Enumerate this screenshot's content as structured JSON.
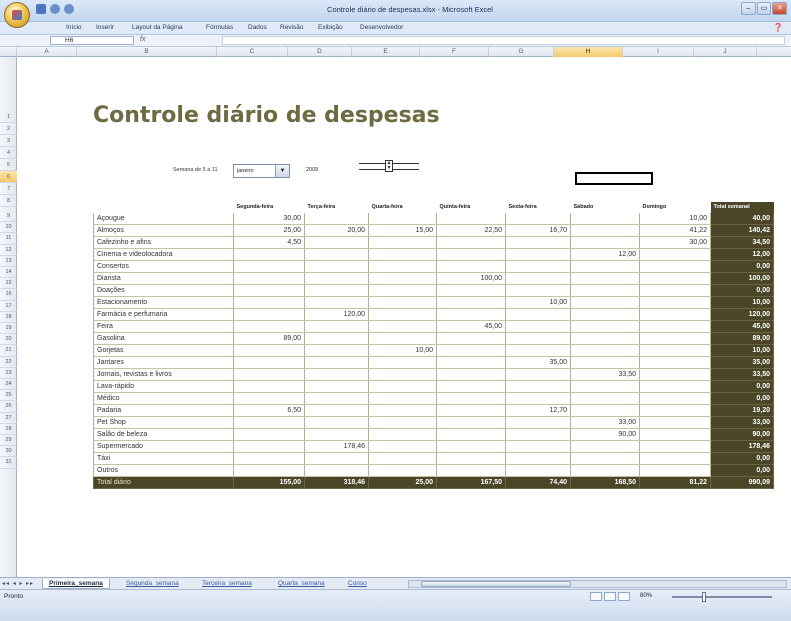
{
  "window": {
    "title": "Controle diário de despesas.xlsx - Microsoft Excel",
    "controls": [
      "–",
      "▭",
      "✕"
    ]
  },
  "ribbon": {
    "tabs": [
      "Início",
      "Inserir",
      "Layout da Página",
      "Fórmulas",
      "Dados",
      "Revisão",
      "Exibição",
      "Desenvolvedor"
    ],
    "help": "❓"
  },
  "formula_bar": {
    "name_box": "H6",
    "fx": "fx",
    "value": ""
  },
  "columns": [
    "A",
    "B",
    "C",
    "D",
    "E",
    "F",
    "G",
    "H",
    "I",
    "J"
  ],
  "selected_column": "H",
  "rows": [
    "1",
    "2",
    "3",
    "4",
    "5",
    "6",
    "7",
    "8",
    "9",
    "10",
    "11",
    "12",
    "13",
    "14",
    "15",
    "16",
    "17",
    "18",
    "19",
    "20",
    "21",
    "22",
    "23",
    "24",
    "25",
    "26",
    "27",
    "28",
    "29",
    "30",
    "31"
  ],
  "selected_row": "6",
  "sheet": {
    "title": "Controle diário de despesas",
    "week_label": "Semana de 5 a 11",
    "month": "janeiro",
    "year": "2009",
    "headers": [
      "",
      "Segunda-feira",
      "Terça-feira",
      "Quarta-feira",
      "Quinta-feira",
      "Sexta-feira",
      "Sábado",
      "Domingo",
      "Total semanal"
    ],
    "rows": [
      [
        "Açougue",
        "30,00",
        "",
        "",
        "",
        "",
        "",
        "10,00",
        "40,00"
      ],
      [
        "Almoços",
        "25,00",
        "20,00",
        "15,00",
        "22,50",
        "16,70",
        "",
        "41,22",
        "140,42"
      ],
      [
        "Cafezinho e afins",
        "4,50",
        "",
        "",
        "",
        "",
        "",
        "30,00",
        "34,50"
      ],
      [
        "Cinema e videolocadora",
        "",
        "",
        "",
        "",
        "",
        "12,00",
        "",
        "12,00"
      ],
      [
        "Consertos",
        "",
        "",
        "",
        "",
        "",
        "",
        "",
        "0,00"
      ],
      [
        "Diarista",
        "",
        "",
        "",
        "100,00",
        "",
        "",
        "",
        "100,00"
      ],
      [
        "Doações",
        "",
        "",
        "",
        "",
        "",
        "",
        "",
        "0,00"
      ],
      [
        "Estacionamento",
        "",
        "",
        "",
        "",
        "10,00",
        "",
        "",
        "10,00"
      ],
      [
        "Farmácia e perfumaria",
        "",
        "120,00",
        "",
        "",
        "",
        "",
        "",
        "120,00"
      ],
      [
        "Feira",
        "",
        "",
        "",
        "45,00",
        "",
        "",
        "",
        "45,00"
      ],
      [
        "Gasolina",
        "89,00",
        "",
        "",
        "",
        "",
        "",
        "",
        "89,00"
      ],
      [
        "Gorjetas",
        "",
        "",
        "10,00",
        "",
        "",
        "",
        "",
        "10,00"
      ],
      [
        "Jantares",
        "",
        "",
        "",
        "",
        "35,00",
        "",
        "",
        "35,00"
      ],
      [
        "Jornais, revistas e livros",
        "",
        "",
        "",
        "",
        "",
        "33,50",
        "",
        "33,50"
      ],
      [
        "Lava-rápido",
        "",
        "",
        "",
        "",
        "",
        "",
        "",
        "0,00"
      ],
      [
        "Médico",
        "",
        "",
        "",
        "",
        "",
        "",
        "",
        "0,00"
      ],
      [
        "Padaria",
        "6,50",
        "",
        "",
        "",
        "12,70",
        "",
        "",
        "19,20"
      ],
      [
        "Pet Shop",
        "",
        "",
        "",
        "",
        "",
        "33,00",
        "",
        "33,00"
      ],
      [
        "Salão de beleza",
        "",
        "",
        "",
        "",
        "",
        "90,00",
        "",
        "90,00"
      ],
      [
        "Supermercado",
        "",
        "178,46",
        "",
        "",
        "",
        "",
        "",
        "178,46"
      ],
      [
        "Táxi",
        "",
        "",
        "",
        "",
        "",
        "",
        "",
        "0,00"
      ],
      [
        "Outros",
        "",
        "",
        "",
        "",
        "",
        "",
        "",
        "0,00"
      ]
    ],
    "total_row": [
      "Total diário",
      "155,00",
      "318,46",
      "25,00",
      "167,50",
      "74,40",
      "168,50",
      "81,22",
      "990,09"
    ]
  },
  "sheet_tabs": {
    "nav": "◂◂ ◂ ▸ ▸▸",
    "tabs": [
      "Primeira_semana",
      "Segunda_semana",
      "Terceira_semana",
      "Quarta_semana",
      "Conso"
    ],
    "active": 0
  },
  "status_bar": {
    "status": "Pronto",
    "zoom": "80%"
  },
  "colors": {
    "accent": "#4a4627",
    "title": "#6e6a41",
    "selection": "#f4c869"
  }
}
